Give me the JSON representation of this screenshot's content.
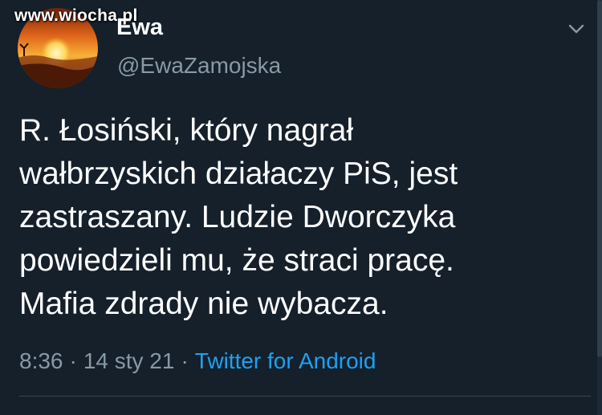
{
  "watermark": "www.wiocha.pl",
  "author": {
    "display_name": "Ewa",
    "handle": "@EwaZamojska",
    "avatar_icon": "sunset-avatar-icon"
  },
  "tweet": {
    "lines": [
      "R. Łosiński, który nagrał",
      "wałbrzyskich działaczy PiS, jest",
      "zastraszany. Ludzie Dworczyka",
      "powiedzieli mu, że straci pracę.",
      "Mafia zdrady nie wybacza."
    ],
    "time": "8:36",
    "date": "14 sty 21",
    "separator": "·",
    "source": "Twitter for Android"
  },
  "colors": {
    "background": "#15202b",
    "secondary_text": "#8899a6",
    "link": "#1da1f2"
  },
  "menu_icon": "chevron-down-icon"
}
